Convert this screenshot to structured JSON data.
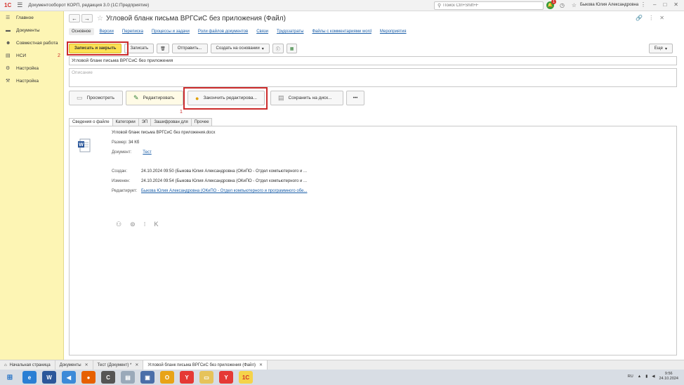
{
  "app": {
    "logo": "1С",
    "title": "Документооборот КОРП, редакция 3.0  (1С:Предприятие)",
    "search_placeholder": "Поиск Ctrl+Shift+F",
    "notif_count": "1",
    "user": "Быкова Юлия Александровна"
  },
  "sidebar": {
    "items": [
      {
        "label": "Главное",
        "icon": "menu-lines-icon"
      },
      {
        "label": "Документы",
        "icon": "folder-icon"
      },
      {
        "label": "Совместная работа",
        "icon": "people-icon"
      },
      {
        "label": "НСИ",
        "icon": "book-icon"
      },
      {
        "label": "Настройка",
        "icon": "gear-icon"
      },
      {
        "label": "Настройка",
        "icon": "sliders-icon"
      }
    ]
  },
  "document": {
    "title": "Угловой бланк письма ВРГСиС без приложения (Файл)",
    "tabs": [
      "Основное",
      "Версии",
      "Переписка",
      "Процессы и задачи",
      "Роли файлов документов",
      "Связи",
      "Трудозатраты",
      "Файлы с комментариями word",
      "Мероприятия"
    ],
    "toolbar": {
      "save_close": "Записать и закрыть",
      "save": "Записать",
      "send": "Отправить...",
      "create_based": "Создать на основании",
      "more": "Еще"
    },
    "name_value": "Угловой бланк письма ВРГСиС без приложения",
    "description_placeholder": "Описание",
    "actions": {
      "view": "Просмотреть",
      "edit": "Редактировать",
      "finish_edit": "Закончить редактирова...",
      "save_disk": "Сохранить на диск...",
      "dots": "•••"
    },
    "annotations": {
      "one": "1",
      "two": "2"
    },
    "subtabs": [
      "Сведения о файле",
      "Категории",
      "ЭП",
      "Зашифрован для",
      "Прочее"
    ],
    "file": {
      "name": "Угловой бланк письма ВРГСиС без приложения.docx",
      "size_label": "Размер:",
      "size_value": "34 Кб",
      "doc_label": "Документ:",
      "doc_value": "Тест",
      "created_label": "Создан:",
      "created_value": "24.10.2024 09:50 (Быкова Юлия Александровна (ОКиПО - Отдел компьютерного и ...",
      "changed_label": "Изменен:",
      "changed_value": "24.10.2024 09:54 (Быкова Юлия Александровна (ОКиПО - Отдел компьютерного и ...",
      "editing_label": "Редактирует:",
      "editing_value": "Быкова Юлия Александровна (ОКиПО - Отдел компьютерного и программного обе..."
    }
  },
  "window_tabs": [
    {
      "label": "Начальная страница",
      "home": true
    },
    {
      "label": "Документы"
    },
    {
      "label": "Тест (Документ) *"
    },
    {
      "label": "Угловой бланк письма ВРГСиС без приложения (Файл)"
    }
  ],
  "taskbar": {
    "lang": "RU",
    "time": "9:56",
    "date": "24.10.2024"
  }
}
